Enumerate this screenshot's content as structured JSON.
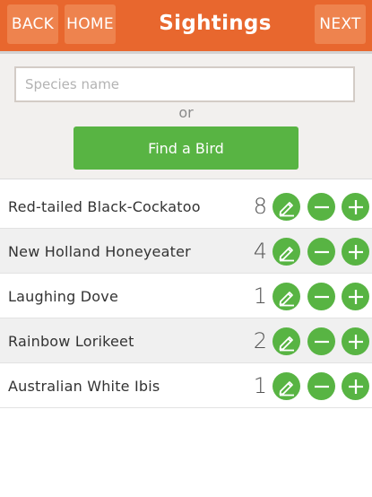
{
  "header": {
    "back_label": "BACK",
    "home_label": "HOME",
    "title": "Sightings",
    "next_label": "NEXT"
  },
  "search": {
    "placeholder": "Species name",
    "or_label": "or",
    "find_label": "Find a Bird"
  },
  "sightings": [
    {
      "name": "Red-tailed Black-Cockatoo",
      "count": "8"
    },
    {
      "name": "New Holland Honeyeater",
      "count": "4"
    },
    {
      "name": "Laughing Dove",
      "count": "1"
    },
    {
      "name": "Rainbow Lorikeet",
      "count": "2"
    },
    {
      "name": "Australian White Ibis",
      "count": "1"
    }
  ],
  "colors": {
    "header": "#e8672e",
    "header_button": "#ee834e",
    "accent_green": "#58b443",
    "search_bg": "#f2f0ee"
  },
  "icons": [
    "pencil-icon",
    "minus-icon",
    "plus-icon"
  ]
}
